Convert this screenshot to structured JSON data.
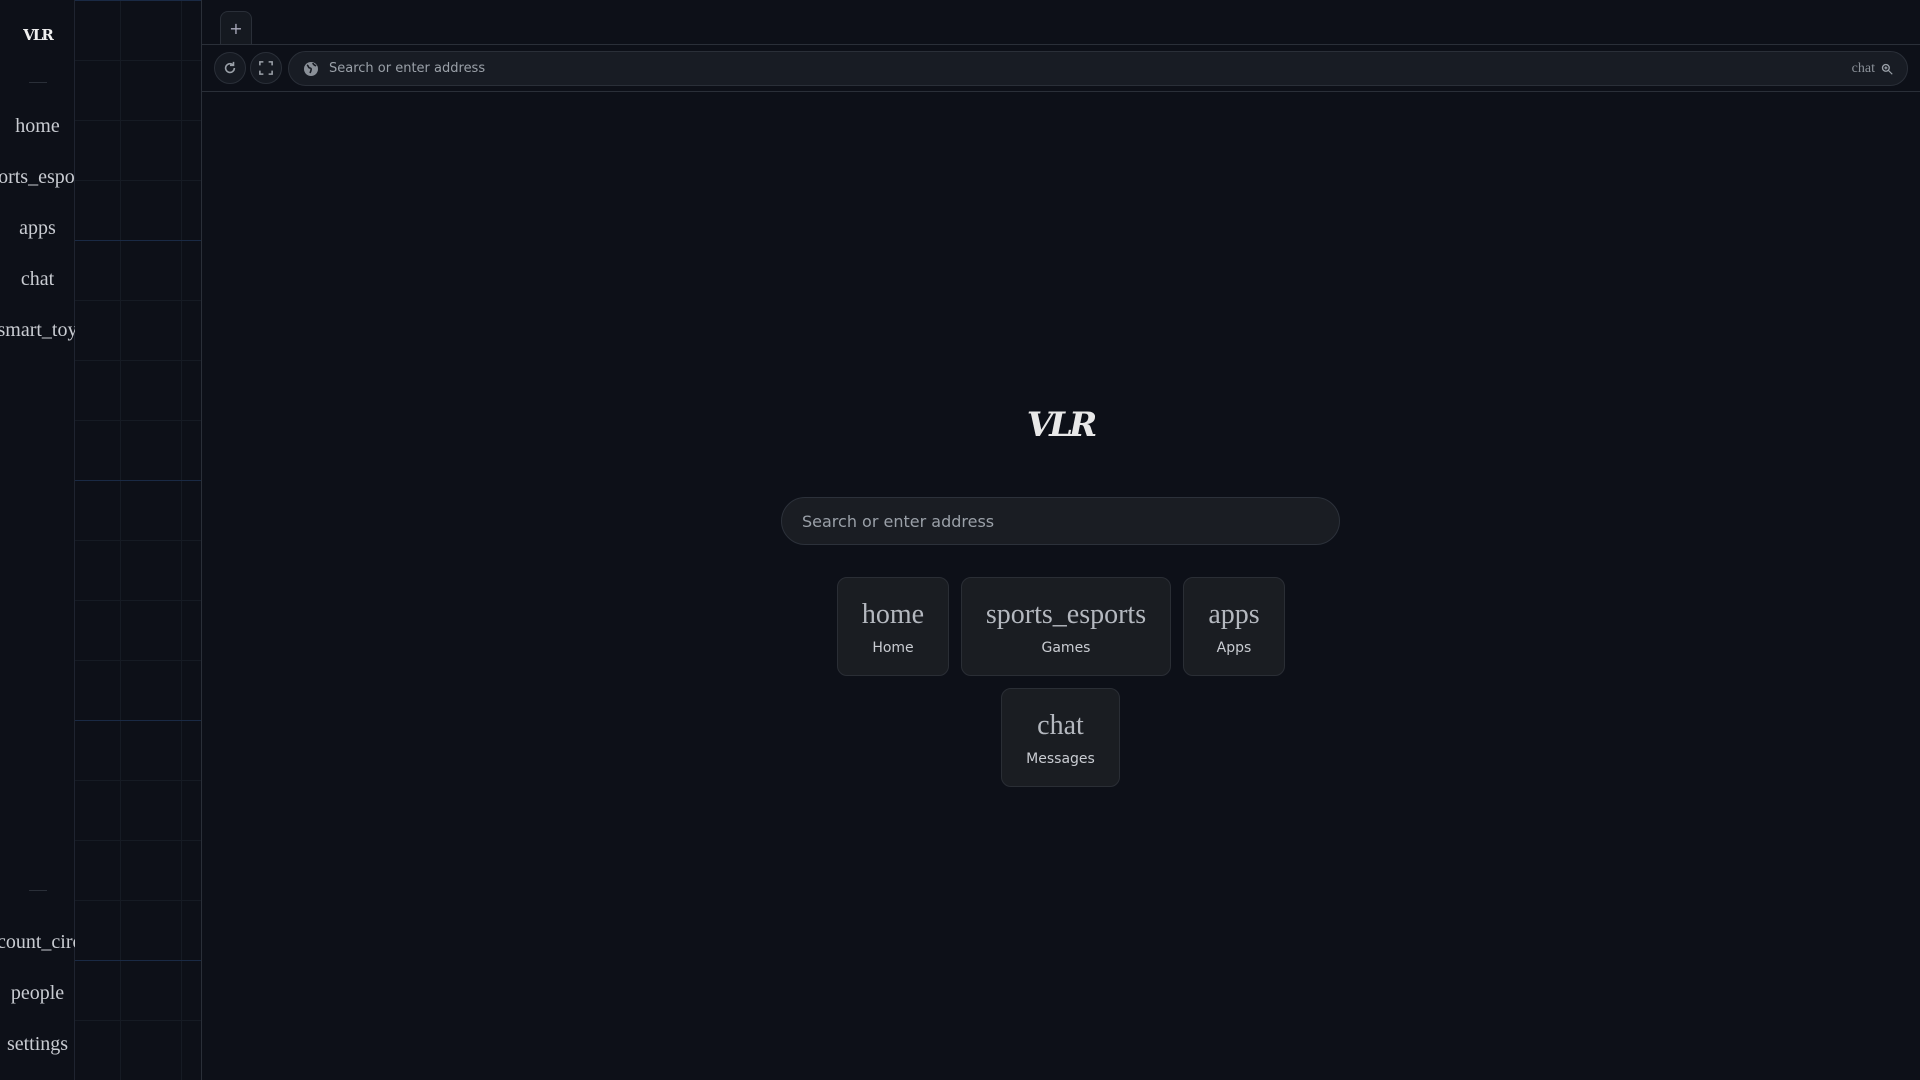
{
  "sidebar": {
    "logo": "VLR",
    "items_top": [
      {
        "icon": "home"
      },
      {
        "icon": "sports_esports"
      },
      {
        "icon": "apps"
      },
      {
        "icon": "chat"
      },
      {
        "icon": "smart_toy"
      }
    ],
    "items_bottom": [
      {
        "icon": "account_circle"
      },
      {
        "icon": "people"
      },
      {
        "icon": "settings"
      }
    ]
  },
  "tabs": {
    "new_tab_label": "+"
  },
  "toolbar": {
    "address_placeholder": "Search or enter address",
    "right_label": "chat"
  },
  "home": {
    "logo": "VLR",
    "search_placeholder": "Search or enter address",
    "shortcuts": [
      {
        "icon": "home",
        "label": "Home"
      },
      {
        "icon": "sports_esports",
        "label": "Games"
      },
      {
        "icon": "apps",
        "label": "Apps"
      },
      {
        "icon": "chat",
        "label": "Messages"
      }
    ]
  }
}
